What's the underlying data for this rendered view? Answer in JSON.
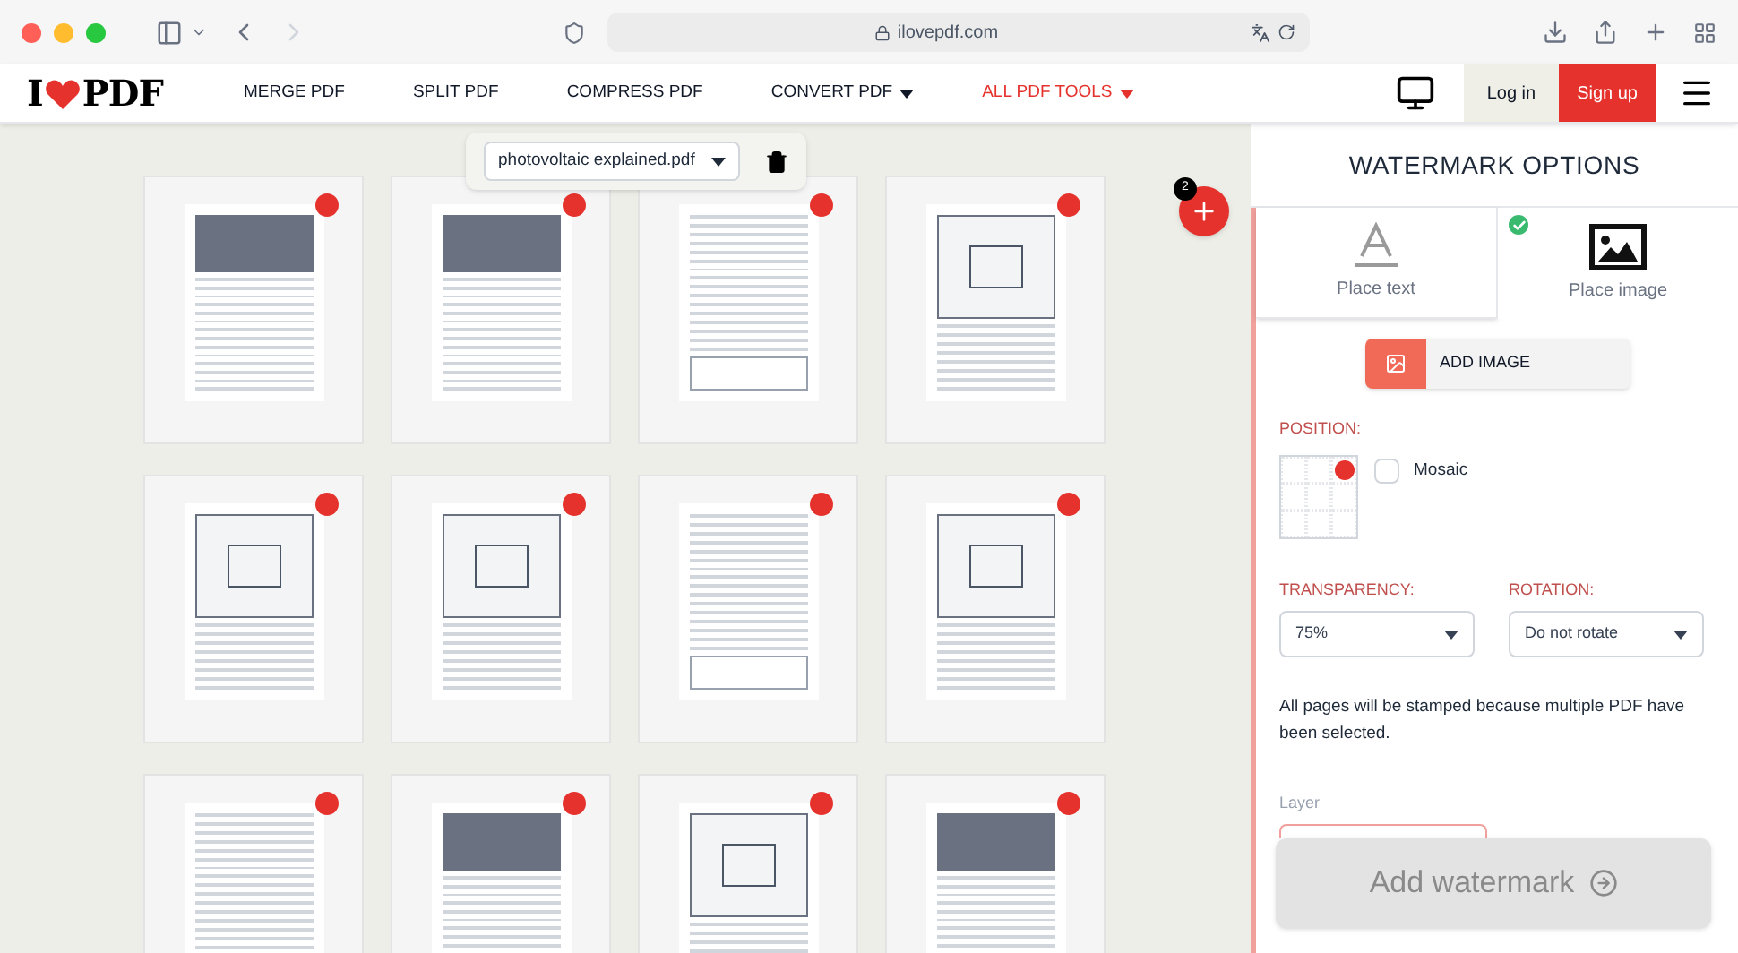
{
  "browser": {
    "url": "ilovepdf.com"
  },
  "logo": {
    "left": "I",
    "right": "PDF"
  },
  "nav": [
    {
      "label": "MERGE PDF",
      "dropdown": false,
      "accent": false
    },
    {
      "label": "SPLIT PDF",
      "dropdown": false,
      "accent": false
    },
    {
      "label": "COMPRESS PDF",
      "dropdown": false,
      "accent": false
    },
    {
      "label": "CONVERT PDF",
      "dropdown": true,
      "accent": false
    },
    {
      "label": "ALL PDF TOOLS",
      "dropdown": true,
      "accent": true
    }
  ],
  "account": {
    "login": "Log in",
    "signup": "Sign up"
  },
  "file_selector": {
    "value": "photovoltaic explained.pdf"
  },
  "add_files": {
    "count": "2"
  },
  "pages": [
    {
      "kind": "photo"
    },
    {
      "kind": "photo"
    },
    {
      "kind": "text"
    },
    {
      "kind": "diagram"
    },
    {
      "kind": "diagram"
    },
    {
      "kind": "diagram"
    },
    {
      "kind": "text"
    },
    {
      "kind": "diagram"
    },
    {
      "kind": "text"
    },
    {
      "kind": "photo"
    },
    {
      "kind": "diagram"
    },
    {
      "kind": "photo"
    }
  ],
  "panel": {
    "title": "WATERMARK OPTIONS",
    "tabs": [
      {
        "kind": "text",
        "label": "Place text",
        "selected": false
      },
      {
        "kind": "image",
        "label": "Place image",
        "selected": true
      }
    ],
    "add_image": "ADD IMAGE",
    "position_label": "POSITION:",
    "position": [
      {
        "selected": false
      },
      {
        "selected": false
      },
      {
        "selected": true
      },
      {
        "selected": false
      },
      {
        "selected": false
      },
      {
        "selected": false
      },
      {
        "selected": false
      },
      {
        "selected": false
      },
      {
        "selected": false
      }
    ],
    "mosaic": {
      "label": "Mosaic",
      "checked": false
    },
    "transparency": {
      "label": "TRANSPARENCY:",
      "value": "75%"
    },
    "rotation": {
      "label": "ROTATION:",
      "value": "Do not rotate"
    },
    "note": "All pages will be stamped because multiple PDF have been selected.",
    "layer_label": "Layer",
    "submit": {
      "label": "Add watermark",
      "disabled": true
    }
  }
}
